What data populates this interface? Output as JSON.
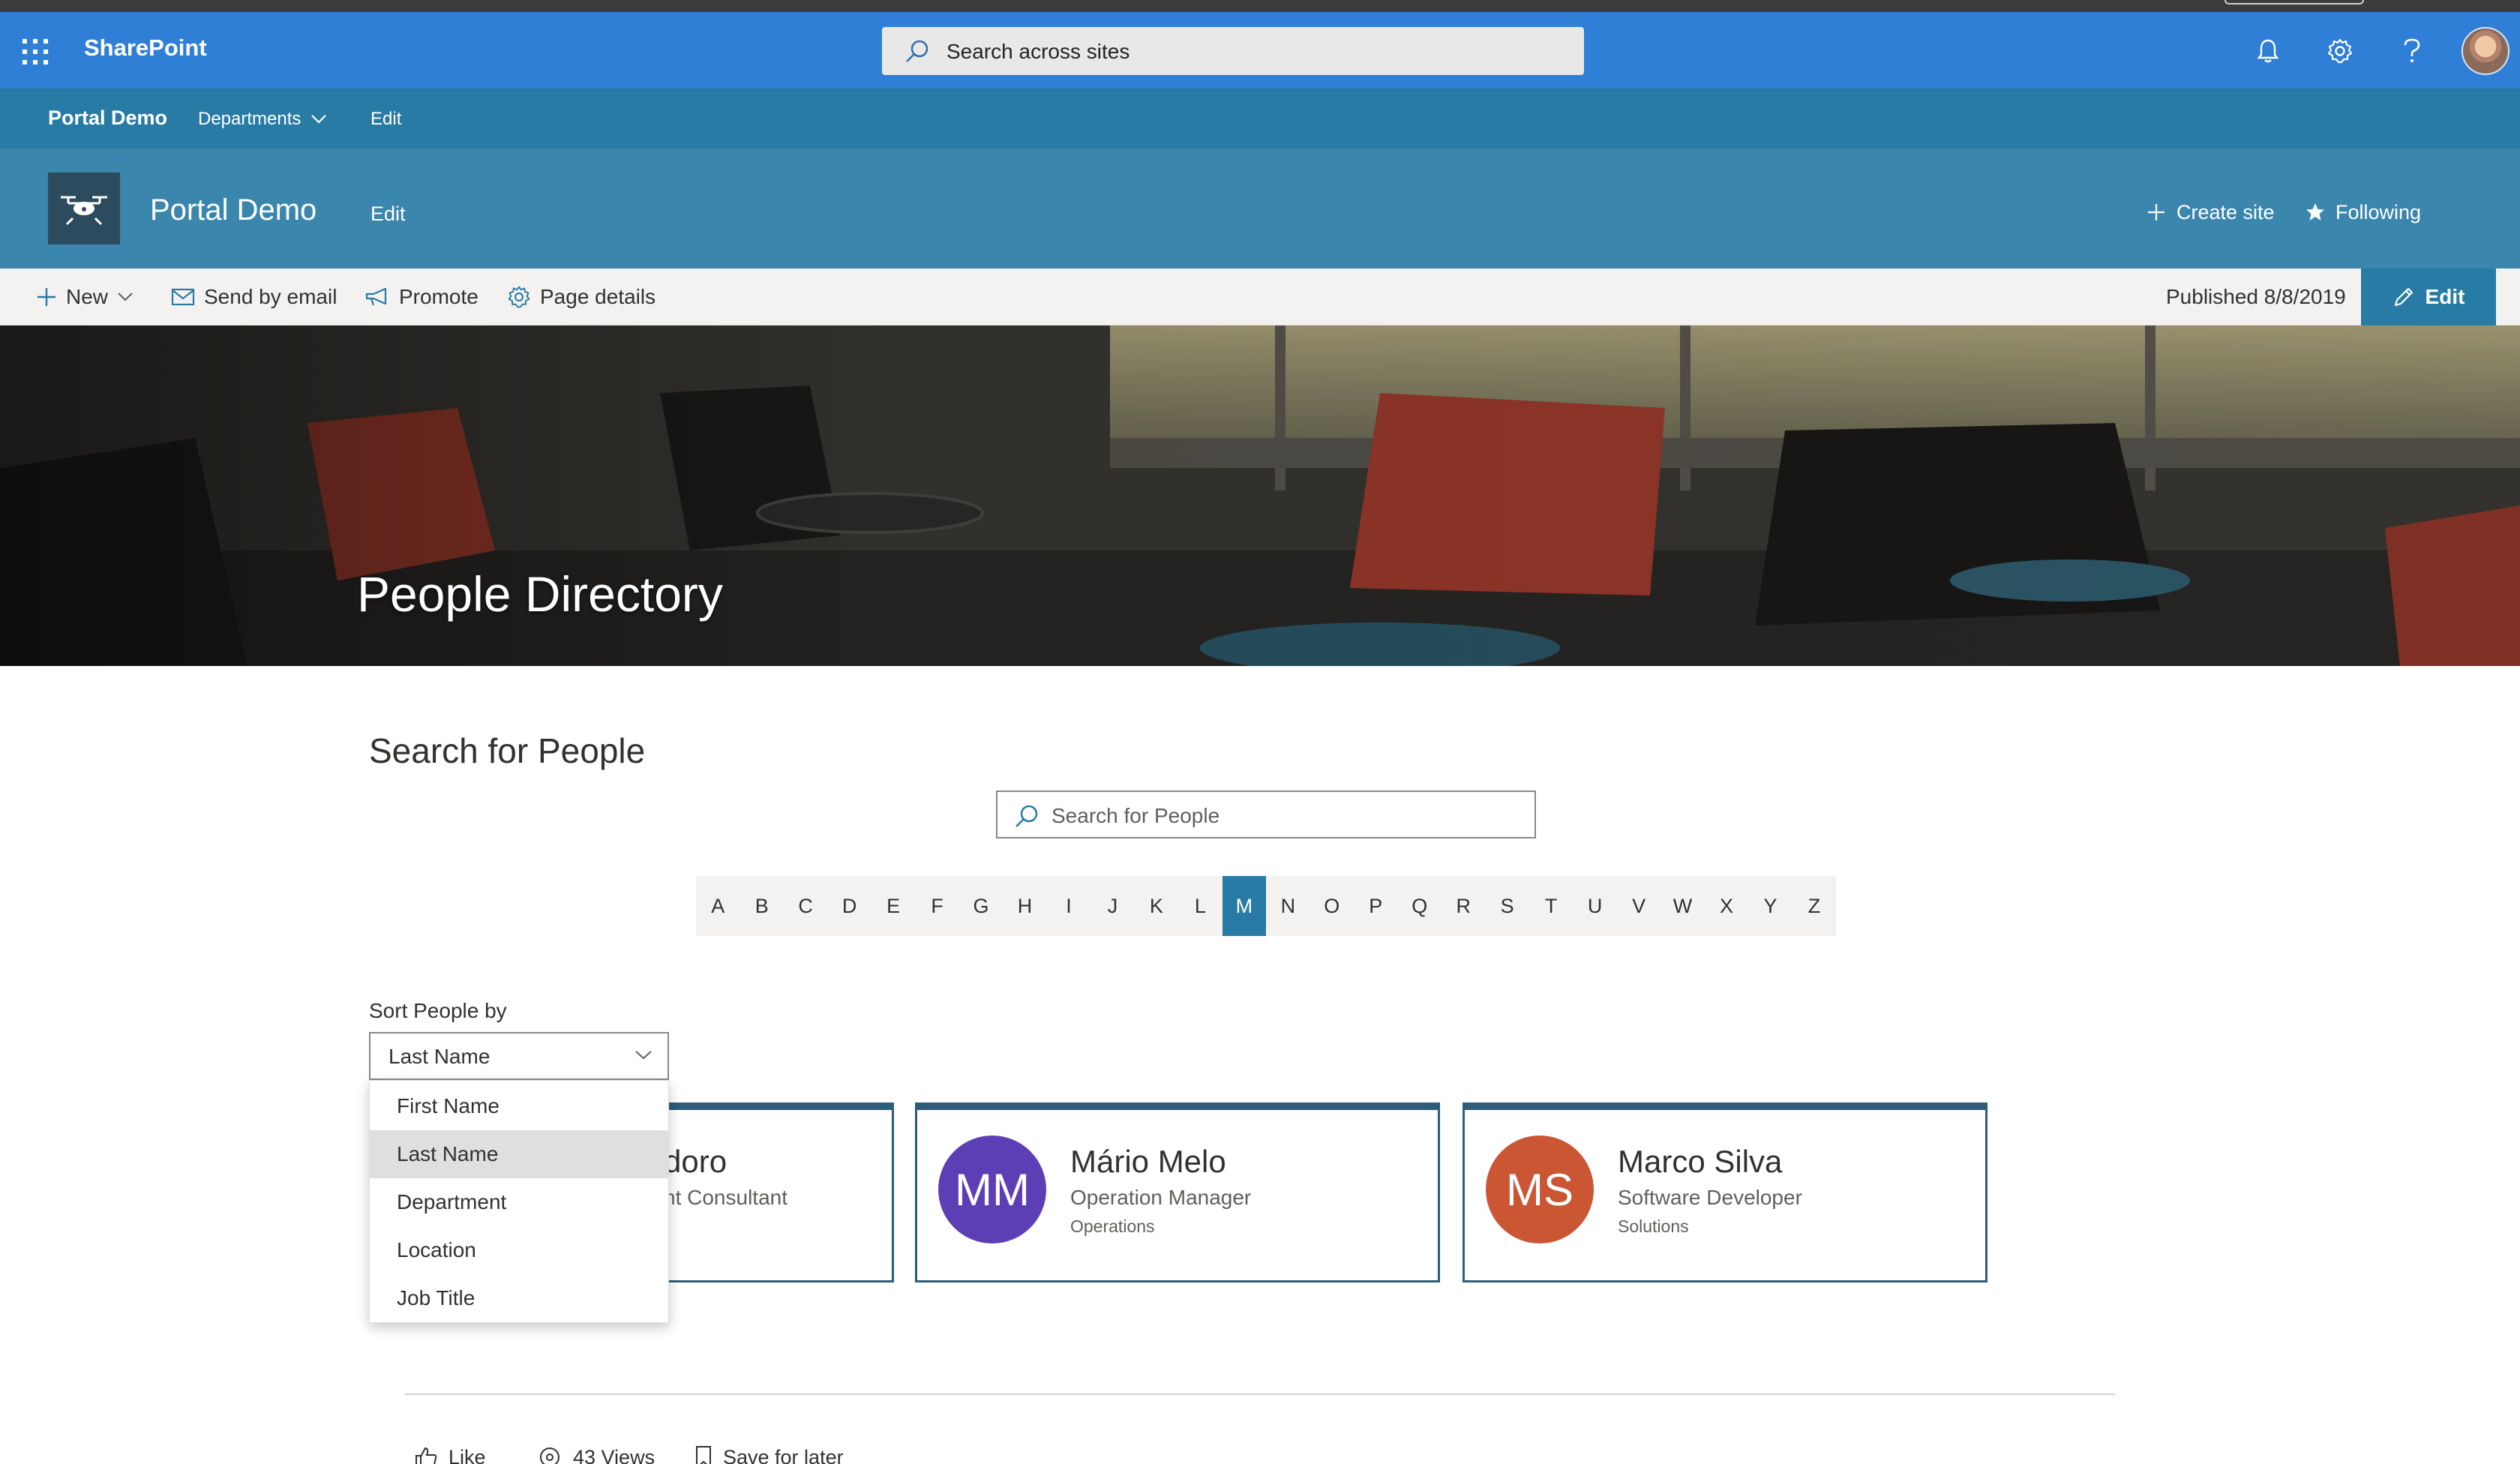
{
  "suite_bar": {
    "app_name": "SharePoint",
    "search_placeholder": "Search across sites",
    "bg_color": "#2f7fd6",
    "icons": [
      "app-launcher-icon",
      "bell-icon",
      "gear-icon",
      "help-icon"
    ]
  },
  "hub_nav": {
    "home": "Portal Demo",
    "departments": "Departments",
    "edit": "Edit"
  },
  "site_header": {
    "title": "Portal Demo",
    "edit": "Edit",
    "create_site": "Create site",
    "following": "Following",
    "logo_icon": "drone-icon"
  },
  "command_bar": {
    "new": "New",
    "send_by_email": "Send by email",
    "promote": "Promote",
    "page_details": "Page details",
    "published": "Published 8/8/2019",
    "edit": "Edit",
    "accent_color": "#287ba5"
  },
  "hero": {
    "title": "People Directory"
  },
  "people_search": {
    "section_title": "Search for People",
    "placeholder": "Search for People"
  },
  "alphabet": {
    "letters": [
      "A",
      "B",
      "C",
      "D",
      "E",
      "F",
      "G",
      "H",
      "I",
      "J",
      "K",
      "L",
      "M",
      "N",
      "O",
      "P",
      "Q",
      "R",
      "S",
      "T",
      "U",
      "V",
      "W",
      "X",
      "Y",
      "Z"
    ],
    "active": "M"
  },
  "sort": {
    "label": "Sort People by",
    "selected": "Last Name",
    "options": [
      "First Name",
      "Last Name",
      "Department",
      "Location",
      "Job Title"
    ]
  },
  "cards": [
    {
      "name": "doro",
      "title": "nt Consultant",
      "department": ""
    },
    {
      "initials": "MM",
      "name": "Mário Melo",
      "title": "Operation Manager",
      "department": "Operations",
      "color": "#5c3fb5"
    },
    {
      "initials": "MS",
      "name": "Marco Silva",
      "title": "Software Developer",
      "department": "Solutions",
      "color": "#ca5634"
    }
  ],
  "footer": {
    "like": "Like",
    "views": "43 Views",
    "save_for_later": "Save for later"
  }
}
